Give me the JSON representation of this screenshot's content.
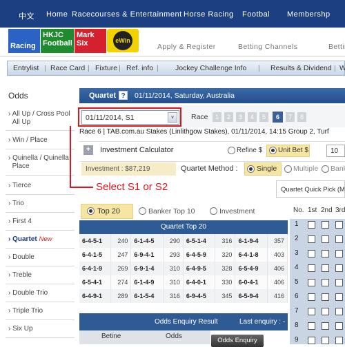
{
  "topnav": {
    "lang": "中文",
    "home": "Home",
    "racecourses": "Racecourses & Entertainment",
    "horse_racing": "Horse Racing",
    "football": "Footbal",
    "membership": "Membershp"
  },
  "logos": {
    "racing": "Racing",
    "hkjc_football": "HKJC Football",
    "mark_six": "Mark Six",
    "ewin": "eWin"
  },
  "toplinks": {
    "apply": "Apply & Register",
    "betting_channels": "Betting Channels",
    "more": "Bettir"
  },
  "subnav": {
    "entrylist": "Entrylist",
    "racecard": "Race Card",
    "fixture": "Fixture",
    "ref_info": "Ref. info",
    "jockey": "Jockey Challenge Info",
    "results": "Results & Dividend",
    "more": "W"
  },
  "sidebar": {
    "heading": "Odds",
    "items": [
      {
        "label": "All Up / Cross Pool",
        "label2": "All Up"
      },
      {
        "label": "Win / Place"
      },
      {
        "label": "Quinella / Quinella",
        "label2": "Place"
      },
      {
        "label": "Tierce"
      },
      {
        "label": "Trio"
      },
      {
        "label": "First 4"
      },
      {
        "label": "Quartet",
        "badge": "New"
      },
      {
        "label": "Double"
      },
      {
        "label": "Treble"
      },
      {
        "label": "Double Trio"
      },
      {
        "label": "Triple Trio"
      },
      {
        "label": "Six Up"
      }
    ]
  },
  "title": {
    "label": "Quartet",
    "help": "?",
    "date": "01/11/2014, Saturday, Australia"
  },
  "meeting": {
    "value": "01/11/2014, S1",
    "arrow": "v"
  },
  "race": {
    "label": "Race",
    "numbers": [
      "1",
      "2",
      "3",
      "4",
      "5",
      "6",
      "7",
      "8"
    ],
    "selected": "6"
  },
  "race_info": "Race 6   |  TAB.com.au Stakes (Linlithgow Stakes), 01/11/2014, 14:15  Group 2, Turf",
  "calc": {
    "plus": "+",
    "label": "Investment Calculator",
    "refine": "Refine $",
    "unit_bet": "Unit Bet $",
    "unit_value": "10"
  },
  "investment": "Investment : $87,219",
  "method": {
    "label": "Quartet Method :",
    "single": "Single",
    "multiple": "Multiple",
    "banker": "Banker"
  },
  "quick_pick": "Quartet Quick Pick (Max",
  "annotation": "Select S1 or S2",
  "view_tabs": {
    "top20": "Top 20",
    "banker_top10": "Banker Top 10",
    "investment": "Investment"
  },
  "top20_title": "Quartet Top 20",
  "top20_rows": [
    [
      "6-4-5-1",
      "240",
      "6-1-4-5",
      "290",
      "6-5-1-4",
      "316",
      "6-1-9-4",
      "357"
    ],
    [
      "6-4-1-5",
      "247",
      "6-9-4-1",
      "293",
      "6-4-5-9",
      "320",
      "6-4-1-8",
      "403"
    ],
    [
      "6-4-1-9",
      "269",
      "6-9-1-4",
      "310",
      "6-4-9-5",
      "328",
      "6-5-4-9",
      "406"
    ],
    [
      "6-5-4-1",
      "274",
      "6-1-4-9",
      "310",
      "6-4-0-1",
      "330",
      "6-0-4-1",
      "406"
    ],
    [
      "6-4-9-1",
      "289",
      "6-1-5-4",
      "316",
      "6-9-4-5",
      "345",
      "6-5-9-4",
      "416"
    ]
  ],
  "enquiry": {
    "title": "Odds Enquiry Result",
    "last": "Last enquiry : -",
    "col1": "Betine",
    "col2": "Odds",
    "button": "Odds Enquiry"
  },
  "no_head": {
    "no": "No.",
    "c1": "1st",
    "c2": "2nd",
    "c3": "3rd"
  },
  "runner_numbers": [
    "1",
    "2",
    "3",
    "4",
    "5",
    "6",
    "7",
    "8",
    "9"
  ]
}
